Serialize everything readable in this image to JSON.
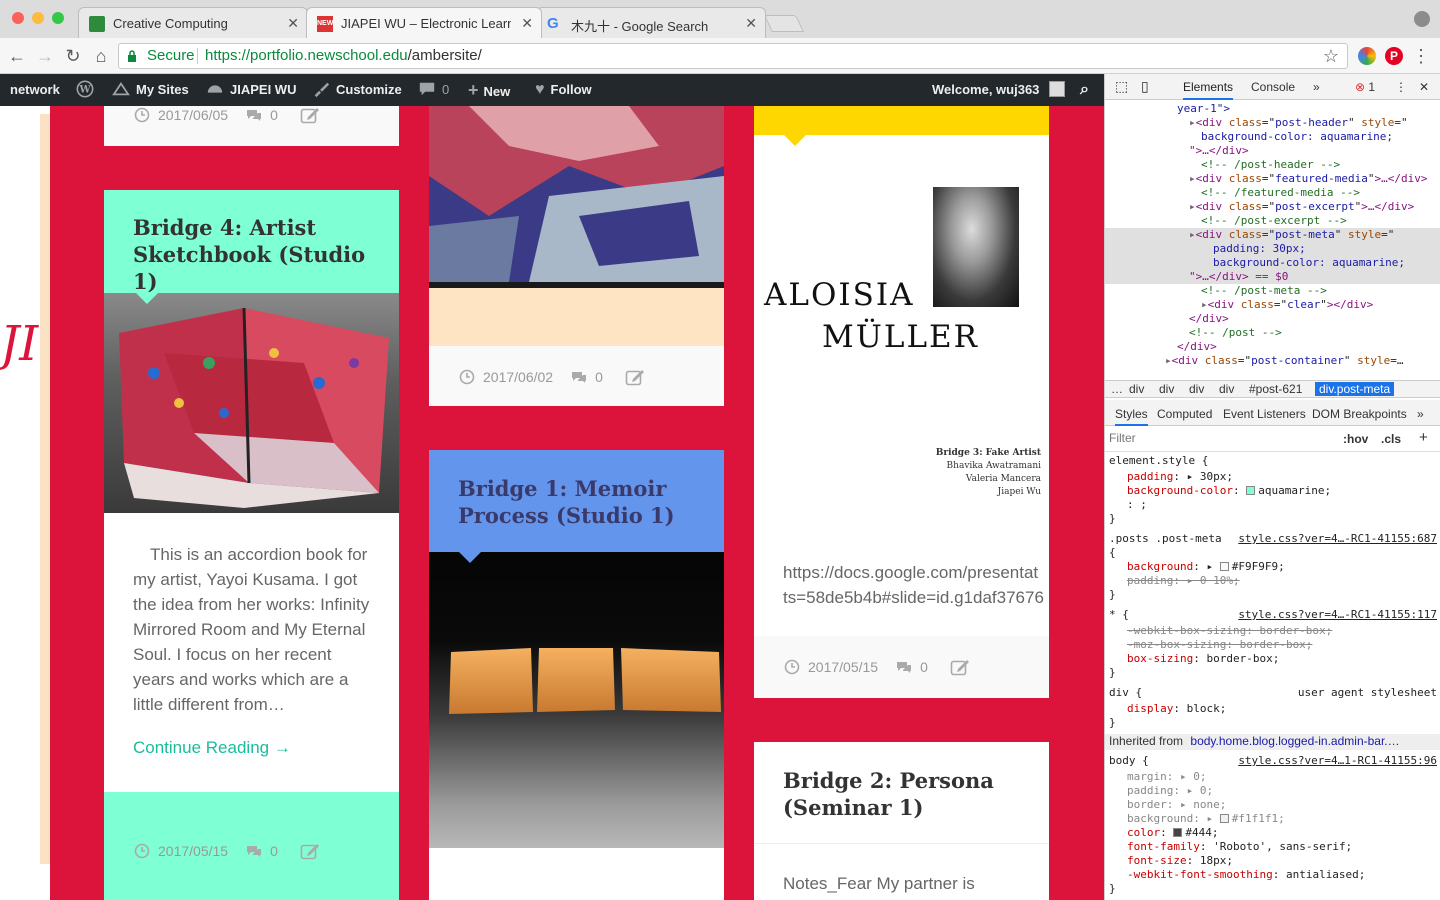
{
  "browser": {
    "tabs": [
      {
        "title": "Creative Computing",
        "active": false
      },
      {
        "title": "JIAPEI WU – Electronic Learning",
        "active": true
      },
      {
        "title": "木九十 - Google Search",
        "active": false
      }
    ],
    "secure_label": "Secure",
    "url_origin": "https://portfolio.newschool.edu",
    "url_path": "/ambersite/",
    "colors": {
      "secure_green": "#0a8a3c",
      "chrome_bg": "#dcdcdc"
    }
  },
  "admin_bar": {
    "network": "network",
    "my_sites": "My Sites",
    "site_name": "JIAPEI WU",
    "customize": "Customize",
    "comments_count": "0",
    "new": "New",
    "follow": "Follow",
    "welcome": "Welcome, wuj363"
  },
  "posts": {
    "col1_top": {
      "date": "2017/06/05",
      "comments": "0"
    },
    "bridge4": {
      "title": "Bridge 4: Artist Sketchbook (Studio 1)",
      "header_color": "#7fffd4",
      "excerpt": "This is an accordion book for my artist, Yayoi Kusama. I got the idea from her works: Infinity Mirrored Room and My Eternal Soul. I focus on her recent years and works which are a little different from…",
      "continue": "Continue Reading →",
      "date": "2017/05/15",
      "comments": "0"
    },
    "col2_top": {
      "date": "2017/06/02",
      "comments": "0"
    },
    "bridge1": {
      "title": "Bridge 1: Memoir Process (Studio 1)",
      "header_color": "#6495ed"
    },
    "col3_top": {
      "poster_name_1": "ALOISIA",
      "poster_name_2": "MÜLLER",
      "poster_credits": [
        "Bridge 3: Fake Artist",
        "Bhavika Awatramani",
        "Valeria Mancera",
        "Jiapei Wu"
      ],
      "link_line1": "https://docs.google.com/presentat",
      "link_line2": "ts=58de5b4b#slide=id.g1daf37676",
      "date": "2017/05/15",
      "comments": "0",
      "header_color": "#ffd700"
    },
    "bridge2": {
      "title": "Bridge 2: Persona (Seminar 1)",
      "excerpt": "Notes_Fear My partner is"
    }
  },
  "devtools": {
    "tabs": {
      "elements": "Elements",
      "console": "Console",
      "more": "»",
      "errors": "1"
    },
    "dom_lines": [
      {
        "indent": 6,
        "html": "year-1\">"
      },
      {
        "indent": 7,
        "open": "div",
        "attr": "class",
        "val": "post-header",
        "attr2": "style",
        "val2": "\""
      },
      {
        "indent": 8,
        "text": "background-color: aquamarine;"
      },
      {
        "indent": 7,
        "text": "\">…</div>"
      },
      {
        "indent": 8,
        "comment": "<!-- /post-header -->"
      },
      {
        "indent": 7,
        "open": "div",
        "attr": "class",
        "val": "featured-media",
        "tail": ">…</div>"
      },
      {
        "indent": 8,
        "comment": "<!-- /featured-media -->"
      },
      {
        "indent": 7,
        "open": "div",
        "attr": "class",
        "val": "post-excerpt",
        "tail": ">…</div>"
      },
      {
        "indent": 8,
        "comment": "<!-- /post-excerpt -->"
      },
      {
        "indent": 7,
        "open": "div",
        "attr": "class",
        "val": "post-meta",
        "attr2": "style",
        "val2": "\"",
        "selected": true
      },
      {
        "indent": 9,
        "text": "padding: 30px;",
        "selected": true
      },
      {
        "indent": 9,
        "text": "background-color: aquamarine;",
        "selected": true
      },
      {
        "indent": 7,
        "text": "\">…</div> == $0",
        "selected": true
      },
      {
        "indent": 8,
        "comment": "<!-- /post-meta -->"
      },
      {
        "indent": 8,
        "open": "div",
        "attr": "class",
        "val": "clear",
        "tail": "></div>"
      },
      {
        "indent": 7,
        "text": "</div>"
      },
      {
        "indent": 7,
        "comment": "<!-- /post -->"
      },
      {
        "indent": 6,
        "text": "</div>"
      },
      {
        "indent": 5,
        "open": "div",
        "attr": "class",
        "val": "post-container",
        "attr2": "style",
        "val2": "…"
      }
    ],
    "breadcrumbs": [
      "…",
      "div",
      "div",
      "div",
      "div",
      "#post-621",
      "div.post-meta"
    ],
    "style_tabs": [
      "Styles",
      "Computed",
      "Event Listeners",
      "DOM Breakpoints",
      "»"
    ],
    "filter_placeholder": "Filter",
    "filter_hov": ":hov",
    "filter_cls": ".cls",
    "element_style": {
      "selector": "element.style {",
      "padding": "30px;",
      "background_color": "aquamarine;"
    },
    "rule_posts_meta": {
      "selector": ".posts .post-meta",
      "source": "style.css?ver=4…-RC1-41155:687",
      "background": "#F9F9F9;",
      "padding": "0 10%;"
    },
    "rule_star": {
      "selector": "* {",
      "source": "style.css?ver=4…-RC1-41155:117",
      "webkit": "-webkit-box-sizing: border-box;",
      "moz": "-moz-box-sizing: border-box;",
      "box": "border-box;"
    },
    "rule_div": {
      "selector": "div {",
      "source": "user agent stylesheet",
      "display": "block;"
    },
    "inherited": {
      "label": "Inherited from",
      "from": "body.home.blog.logged-in.admin-bar.…"
    },
    "rule_body": {
      "selector": "body {",
      "source": "style.css?ver=4…1-RC1-41155:96",
      "margin": "0;",
      "padding": "0;",
      "border": "none;",
      "background": "#f1f1f1;",
      "color": "#444;",
      "font_family": "'Roboto', sans-serif;",
      "font_size": "18px;",
      "smoothing": "antialiased;"
    }
  }
}
